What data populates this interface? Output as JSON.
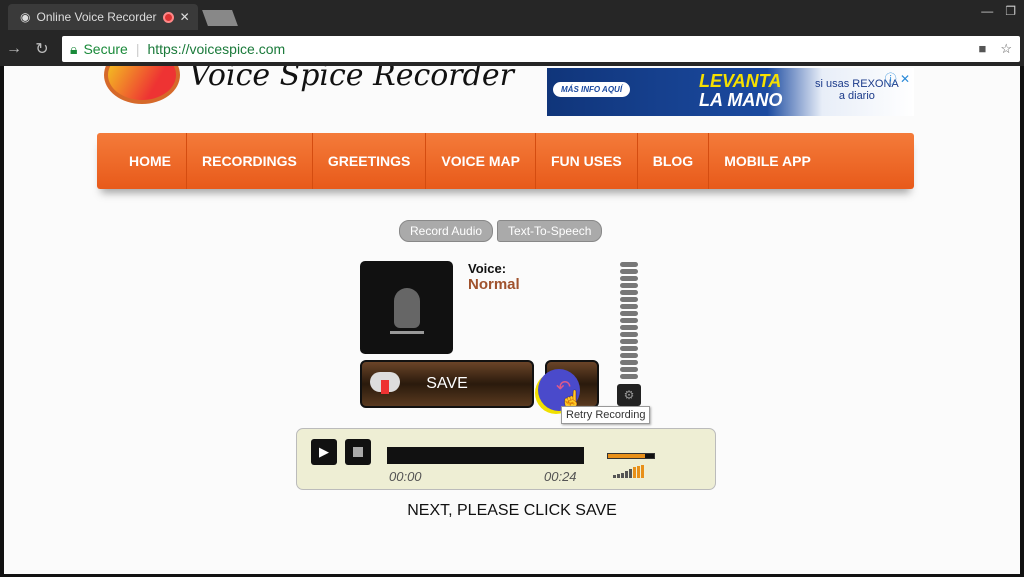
{
  "browser": {
    "tab_title": "Online Voice Recorder",
    "url": "https://voicespice.com",
    "secure_label": "Secure"
  },
  "site": {
    "logo_text": "Voice Spice Recorder"
  },
  "ad": {
    "button": "MÁS INFO AQUÍ",
    "headline1": "LEVANTA",
    "headline2": "LA MANO",
    "tagline1": "si usas REXONA",
    "tagline2": "a diario"
  },
  "menu": [
    "HOME",
    "RECORDINGS",
    "GREETINGS",
    "VOICE MAP",
    "FUN USES",
    "BLOG",
    "MOBILE APP"
  ],
  "modes": {
    "record": "Record Audio",
    "tts": "Text-To-Speech"
  },
  "voice": {
    "label": "Voice:",
    "value": "Normal"
  },
  "buttons": {
    "save": "SAVE",
    "retry_tooltip": "Retry Recording"
  },
  "player": {
    "current_time": "00:00",
    "duration": "00:24",
    "volume_percent": 80
  },
  "instruction": "NEXT, PLEASE CLICK SAVE"
}
